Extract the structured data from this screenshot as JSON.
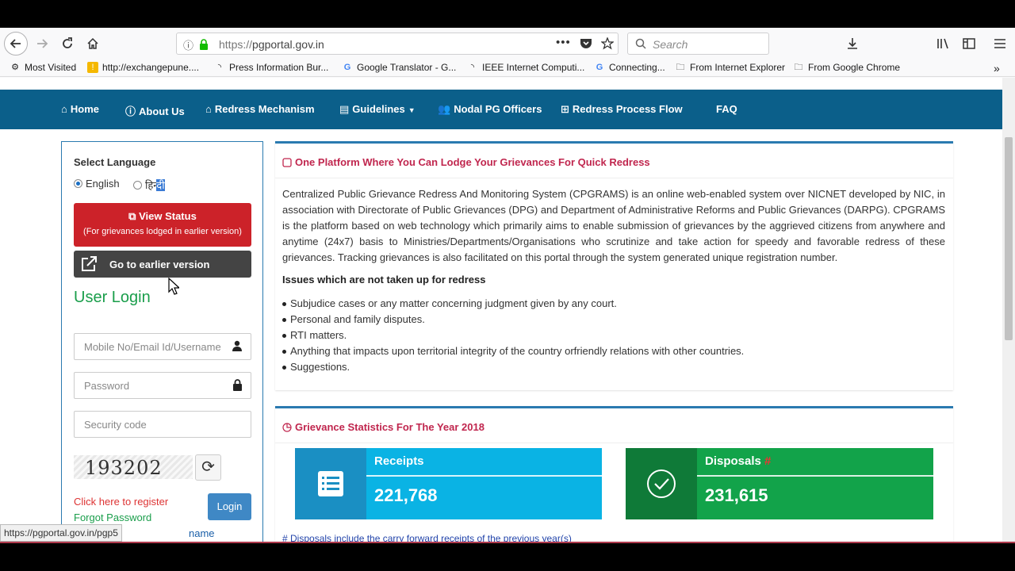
{
  "browser": {
    "url_prefix": "https://",
    "url_domain": "pgportal.gov.in",
    "search_placeholder": "Search",
    "bookmarks": [
      {
        "label": "Most Visited",
        "icon": "gear-icon"
      },
      {
        "label": "http://exchangepune....",
        "icon": "site-icon"
      },
      {
        "label": "Press Information Bur...",
        "icon": "rss-icon"
      },
      {
        "label": "Google Translator - G...",
        "icon": "google-icon"
      },
      {
        "label": "IEEE Internet Computi...",
        "icon": "rss-icon"
      },
      {
        "label": "Connecting...",
        "icon": "google-icon"
      },
      {
        "label": "From Internet Explorer",
        "icon": "folder-icon"
      },
      {
        "label": "From Google Chrome",
        "icon": "folder-icon"
      }
    ],
    "status_url": "https://pgportal.gov.in/pgp5"
  },
  "nav": {
    "items": [
      {
        "label": "Home",
        "icon": "home-icon"
      },
      {
        "label": "About Us",
        "icon": "info-icon"
      },
      {
        "label": "Redress Mechanism",
        "icon": "bank-icon"
      },
      {
        "label": "Guidelines",
        "icon": "book-icon"
      },
      {
        "label": "Nodal PG Officers",
        "icon": "users-icon"
      },
      {
        "label": "Redress Process Flow",
        "icon": "sitemap-icon"
      },
      {
        "label": "FAQ",
        "icon": ""
      }
    ],
    "bar_color": "#0b5f8a"
  },
  "sidebar": {
    "select_language": "Select Language",
    "lang_english": "English",
    "lang_hindi_prefix": "हिन्",
    "lang_hindi_selected": "दी",
    "view_status_title": "View Status",
    "view_status_sub": "(For grievances lodged in earlier version)",
    "earlier_version": "Go to earlier version",
    "user_login": "User Login",
    "username_placeholder": "Mobile No/Email Id/Username",
    "password_placeholder": "Password",
    "security_placeholder": "Security code",
    "captcha": "193202",
    "register": "Click here to register",
    "forgot": "Forgot Password",
    "forgot_username": "name",
    "login": "Login"
  },
  "main": {
    "heading": "One Platform Where You Can Lodge Your Grievances For Quick Redress",
    "description": "Centralized Public Grievance Redress And Monitoring System (CPGRAMS) is an online web-enabled system over NICNET developed by NIC, in association with Directorate of Public Grievances (DPG) and Department of Administrative Reforms and Public Grievances (DARPG). CPGRAMS is the platform based on web technology which primarily aims to enable submission of grievances by the aggrieved citizens from anywhere and anytime (24x7) basis to Ministries/Departments/Organisations who scrutinize and take action for speedy and favorable redress of these grievances. Tracking grievances is also facilitated on this portal through the system generated unique registration number.",
    "issues_title": "Issues which are not taken up for redress",
    "issues": [
      "Subjudice cases or any matter concerning judgment given by any court.",
      "Personal and family disputes.",
      "RTI matters.",
      "Anything that impacts upon territorial integrity of the country orfriendly relations with other countries.",
      "Suggestions."
    ]
  },
  "stats": {
    "heading": "Grievance Statistics For The Year 2018",
    "receipts_label": "Receipts",
    "receipts_value": "221,768",
    "disposals_label": "Disposals",
    "disposals_mark": "#",
    "disposals_value": "231,615",
    "footnote": "# Disposals include the carry forward receipts of the previous year(s)"
  }
}
